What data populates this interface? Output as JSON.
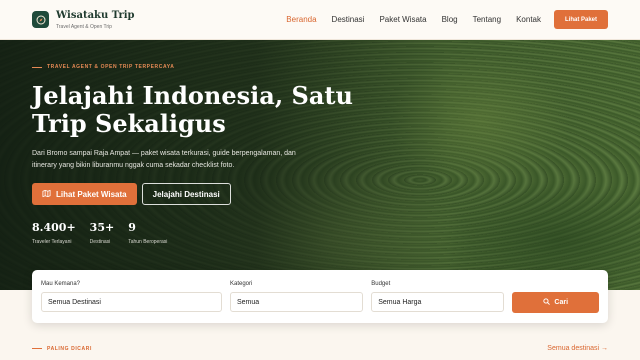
{
  "brand": {
    "name": "Wisataku Trip",
    "tagline": "Travel Agent & Open Trip"
  },
  "nav": {
    "items": [
      {
        "label": "Beranda",
        "active": true
      },
      {
        "label": "Destinasi",
        "active": false
      },
      {
        "label": "Paket Wisata",
        "active": false
      },
      {
        "label": "Blog",
        "active": false
      },
      {
        "label": "Tentang",
        "active": false
      },
      {
        "label": "Kontak",
        "active": false
      }
    ],
    "cta_label": "Lihat Paket"
  },
  "hero": {
    "eyebrow": "TRAVEL AGENT & OPEN TRIP TERPERCAYA",
    "title_line1": "Jelajahi Indonesia, Satu",
    "title_line2": "Trip Sekaligus",
    "description": "Dari Bromo sampai Raja Ampat — paket wisata terkurasi, guide berpengalaman, dan itinerary yang bikin liburanmu nggak cuma sekadar checklist foto.",
    "primary_button": "Lihat Paket Wisata",
    "primary_icon": "map-icon",
    "secondary_button": "Jelajahi Destinasi",
    "stats": [
      {
        "value": "8.400+",
        "label": "Traveler Terlayani"
      },
      {
        "value": "35+",
        "label": "Destinasi"
      },
      {
        "value": "9",
        "label": "Tahun Beroperasi"
      }
    ]
  },
  "search": {
    "destination": {
      "label": "Mau Kemana?",
      "value": "Semua Destinasi"
    },
    "category": {
      "label": "Kategori",
      "value": "Semua"
    },
    "budget": {
      "label": "Budget",
      "value": "Semua Harga"
    },
    "button_label": "Cari",
    "button_icon": "search-icon"
  },
  "section": {
    "eyebrow": "PALING DICARI",
    "link_label": "Semua destinasi →"
  },
  "colors": {
    "accent": "#e0703a",
    "brand_dark": "#1f4a3a",
    "background": "#fbf6ef"
  }
}
